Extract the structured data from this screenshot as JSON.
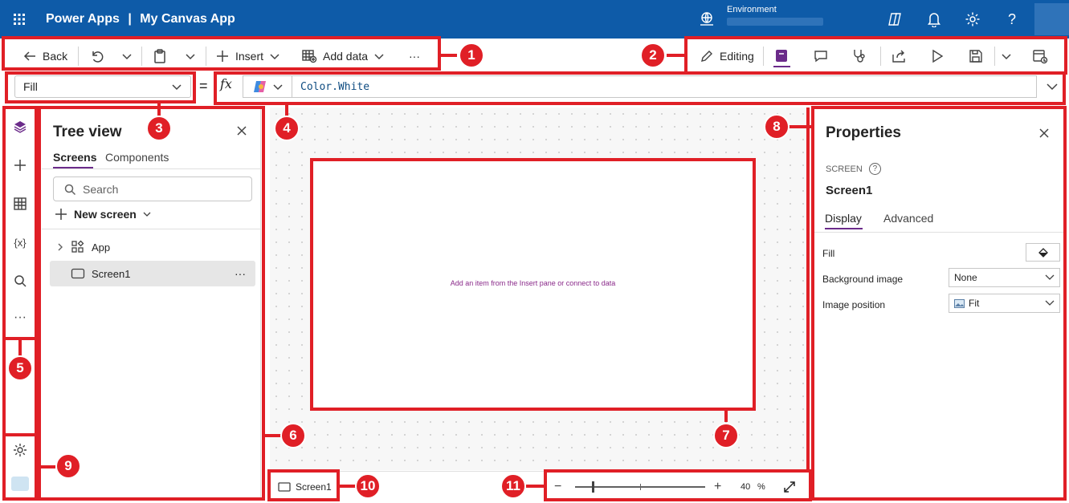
{
  "header": {
    "app_name": "Power Apps",
    "separator": "|",
    "app_title": "My Canvas App",
    "environment_label": "Environment",
    "icons": [
      "waffle-icon",
      "environment-icon",
      "copilot-icon",
      "bell-icon",
      "gear-icon",
      "help-icon"
    ]
  },
  "toolbar": {
    "back_label": "Back",
    "insert_label": "Insert",
    "add_data_label": "Add data",
    "more_label": "···",
    "editing_label": "Editing"
  },
  "formula_bar": {
    "property": "Fill",
    "equals": "=",
    "fx": "fx",
    "formula": "Color.White"
  },
  "tree_view": {
    "title": "Tree view",
    "tabs": [
      "Screens",
      "Components"
    ],
    "search_placeholder": "Search",
    "new_screen_label": "New screen",
    "items": [
      {
        "label": "App"
      },
      {
        "label": "Screen1",
        "more": "···"
      }
    ]
  },
  "canvas": {
    "hint": "Add an item from the Insert pane or connect to data",
    "screen_tab_label": "Screen1",
    "zoom_value": "40",
    "zoom_unit": "%",
    "zoom_level": 0.4
  },
  "properties": {
    "title": "Properties",
    "type_label": "SCREEN",
    "name": "Screen1",
    "tabs": [
      "Display",
      "Advanced"
    ],
    "rows": [
      {
        "label": "Fill"
      },
      {
        "label": "Background image",
        "value": "None"
      },
      {
        "label": "Image position",
        "value": "Fit"
      }
    ]
  },
  "callouts": [
    "1",
    "2",
    "3",
    "4",
    "5",
    "6",
    "7",
    "8",
    "9",
    "10",
    "11"
  ],
  "colors": {
    "header": "#0e5ba8",
    "callout": "#e01f26",
    "accent": "#6b2b8a"
  }
}
